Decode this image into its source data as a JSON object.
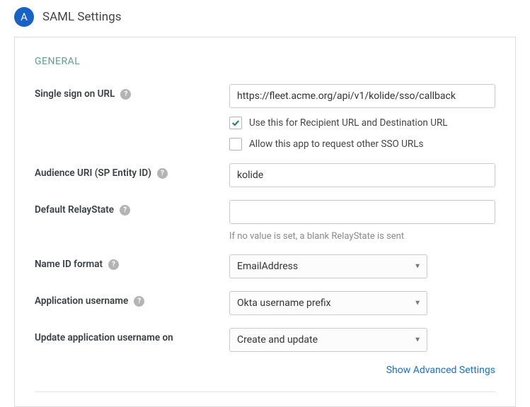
{
  "header": {
    "step_letter": "A",
    "title": "SAML Settings"
  },
  "section": {
    "title": "GENERAL"
  },
  "fields": {
    "sso_url": {
      "label": "Single sign on URL",
      "value": "https://fleet.acme.org/api/v1/kolide/sso/callback",
      "checkbox_use_recipient": "Use this for Recipient URL and Destination URL",
      "checkbox_allow_other": "Allow this app to request other SSO URLs"
    },
    "audience_uri": {
      "label": "Audience URI (SP Entity ID)",
      "value": "kolide"
    },
    "relay_state": {
      "label": "Default RelayState",
      "value": "",
      "helper": "If no value is set, a blank RelayState is sent"
    },
    "name_id_format": {
      "label": "Name ID format",
      "value": "EmailAddress"
    },
    "app_username": {
      "label": "Application username",
      "value": "Okta username prefix"
    },
    "update_username_on": {
      "label": "Update application username on",
      "value": "Create and update"
    }
  },
  "actions": {
    "show_advanced": "Show Advanced Settings"
  }
}
